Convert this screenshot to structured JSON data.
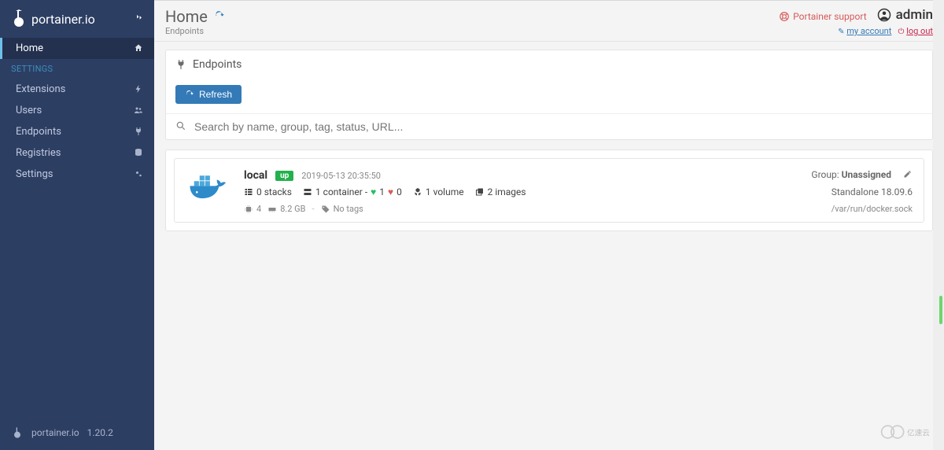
{
  "brand": "portainer.io",
  "version": "1.20.2",
  "sidebar": {
    "items": [
      {
        "label": "Home",
        "icon": "home"
      },
      {
        "label": "SETTINGS",
        "section": true
      },
      {
        "label": "Extensions",
        "icon": "bolt"
      },
      {
        "label": "Users",
        "icon": "users"
      },
      {
        "label": "Endpoints",
        "icon": "plug"
      },
      {
        "label": "Registries",
        "icon": "database"
      },
      {
        "label": "Settings",
        "icon": "cogs"
      }
    ]
  },
  "page": {
    "title": "Home",
    "breadcrumb": "Endpoints"
  },
  "header_right": {
    "support": "Portainer support",
    "user": "admin",
    "my_account": "my account",
    "log_out": "log out"
  },
  "panel": {
    "title": "Endpoints",
    "refresh_label": "Refresh",
    "search_placeholder": "Search by name, group, tag, status, URL..."
  },
  "endpoint": {
    "name": "local",
    "status_badge": "up",
    "timestamp": "2019-05-13 20:35:50",
    "group_label": "Group:",
    "group_value": "Unassigned",
    "stacks": "0 stacks",
    "container": "1 container -",
    "healthy_num": "1",
    "unhealthy_num": "0",
    "volumes": "1 volume",
    "images": "2 images",
    "cpu": "4",
    "ram": "8.2 GB",
    "no_tags": "No tags",
    "type": "Standalone 18.09.6",
    "url": "/var/run/docker.sock"
  }
}
